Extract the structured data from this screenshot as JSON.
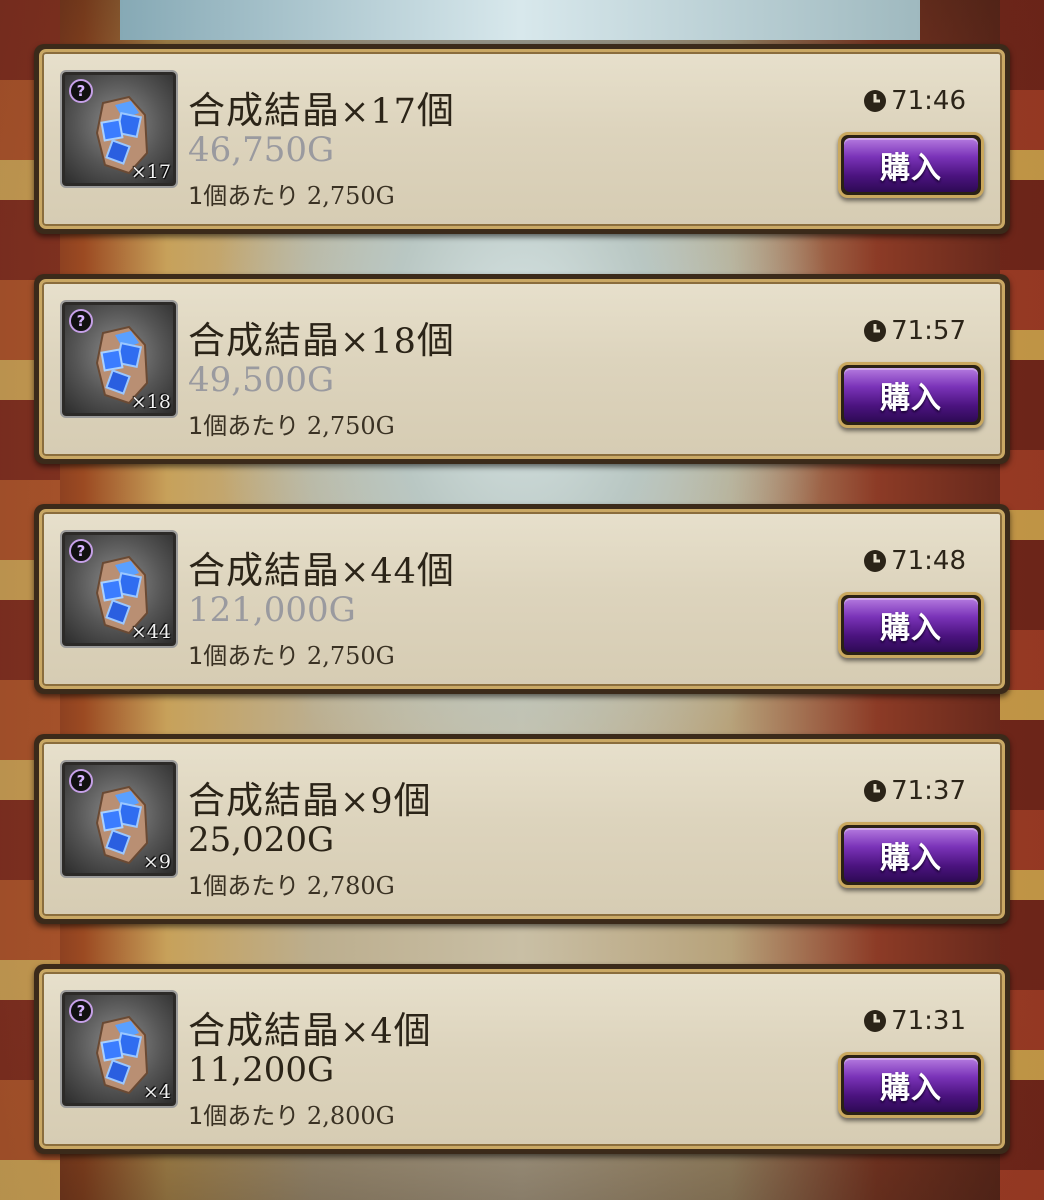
{
  "shop": {
    "buy_label": "購入",
    "unit_prefix": "1個あたり",
    "badge_symbol": "?",
    "items": [
      {
        "name": "合成結晶",
        "times": "×",
        "qty": "17",
        "counter": "個",
        "price": "46,750G",
        "affordable": false,
        "unit_price": "2,750G",
        "timer": "71:46",
        "icon_qty": "×17"
      },
      {
        "name": "合成結晶",
        "times": "×",
        "qty": "18",
        "counter": "個",
        "price": "49,500G",
        "affordable": false,
        "unit_price": "2,750G",
        "timer": "71:57",
        "icon_qty": "×18"
      },
      {
        "name": "合成結晶",
        "times": "×",
        "qty": "44",
        "counter": "個",
        "price": "121,000G",
        "affordable": false,
        "unit_price": "2,750G",
        "timer": "71:48",
        "icon_qty": "×44"
      },
      {
        "name": "合成結晶",
        "times": "×",
        "qty": "9",
        "counter": "個",
        "price": "25,020G",
        "affordable": true,
        "unit_price": "2,780G",
        "timer": "71:37",
        "icon_qty": "×9"
      },
      {
        "name": "合成結晶",
        "times": "×",
        "qty": "4",
        "counter": "個",
        "price": "11,200G",
        "affordable": true,
        "unit_price": "2,800G",
        "timer": "71:31",
        "icon_qty": "×4"
      }
    ]
  },
  "colors": {
    "price_unaffordable": "#9a9a9f",
    "price_affordable": "#2b2418",
    "button_purple": "#4b137f",
    "frame_gold": "#c9a864"
  },
  "icons": {
    "item": "crystal-icon",
    "timer": "clock-icon",
    "rarity": "question-badge-icon"
  }
}
